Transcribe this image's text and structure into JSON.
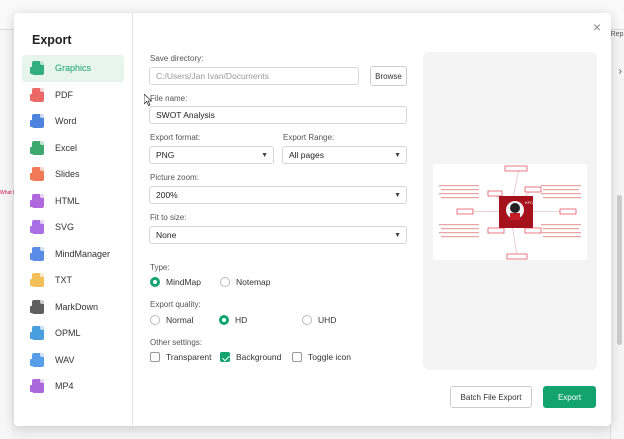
{
  "background": {
    "rep_label": "Rep",
    "what_label": "What h"
  },
  "dialog": {
    "title": "Export",
    "close_glyph": "×",
    "nav": [
      {
        "label": "Graphics",
        "icon": "graphics-file-icon",
        "color": "#13a36f",
        "active": true
      },
      {
        "label": "PDF",
        "icon": "pdf-file-icon",
        "color": "#e8504c",
        "active": false
      },
      {
        "label": "Word",
        "icon": "word-file-icon",
        "color": "#2f6fd8",
        "active": false
      },
      {
        "label": "Excel",
        "icon": "excel-file-icon",
        "color": "#1d9b56",
        "active": false
      },
      {
        "label": "Slides",
        "icon": "slides-file-icon",
        "color": "#f0623a",
        "active": false
      },
      {
        "label": "HTML",
        "icon": "html-file-icon",
        "color": "#a24fd6",
        "active": false
      },
      {
        "label": "SVG",
        "icon": "svg-file-icon",
        "color": "#9a58e0",
        "active": false
      },
      {
        "label": "MindManager",
        "icon": "mindmanager-file-icon",
        "color": "#3d78e0",
        "active": false
      },
      {
        "label": "TXT",
        "icon": "txt-file-icon",
        "color": "#f2b53a",
        "active": false
      },
      {
        "label": "MarkDown",
        "icon": "markdown-file-icon",
        "color": "#444444",
        "active": false
      },
      {
        "label": "OPML",
        "icon": "opml-file-icon",
        "color": "#2a8ed8",
        "active": false
      },
      {
        "label": "WAV",
        "icon": "wav-file-icon",
        "color": "#3a8ee6",
        "active": false
      },
      {
        "label": "MP4",
        "icon": "mp4-file-icon",
        "color": "#9b4fd8",
        "active": false
      }
    ],
    "save_directory": {
      "label": "Save directory:",
      "value": "C:/Users/Jan Ivan/Documents",
      "browse": "Browse"
    },
    "file_name": {
      "label": "File name:",
      "value": "SWOT Analysis"
    },
    "export_format": {
      "label": "Export format:",
      "value": "PNG"
    },
    "export_range": {
      "label": "Export Range:",
      "value": "All pages"
    },
    "picture_zoom": {
      "label": "Picture zoom:",
      "value": "200%"
    },
    "fit_to_size": {
      "label": "Fit to size:",
      "value": "None"
    },
    "type": {
      "label": "Type:",
      "options": [
        "MindMap",
        "Notemap"
      ],
      "selected": "MindMap"
    },
    "quality": {
      "label": "Export quality:",
      "options": [
        "Normal",
        "HD",
        "UHD"
      ],
      "selected": "HD"
    },
    "other": {
      "label": "Other settings:",
      "options": [
        {
          "label": "Transparent",
          "checked": false
        },
        {
          "label": "Background",
          "checked": true
        },
        {
          "label": "Toggle icon",
          "checked": false
        }
      ]
    },
    "preview": {
      "center_label": "KFC"
    },
    "buttons": {
      "batch": "Batch File Export",
      "export": "Export"
    },
    "accent_color": "#13a36f"
  }
}
